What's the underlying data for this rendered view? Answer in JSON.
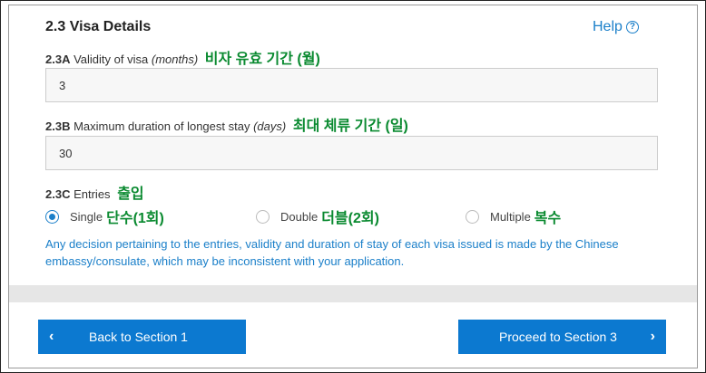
{
  "section": {
    "title": "2.3 Visa Details",
    "help_label": "Help",
    "help_icon": "?"
  },
  "validity": {
    "code": "2.3A",
    "label": "Validity of visa",
    "unit": "(months)",
    "korean": "비자 유효 기간 (월)",
    "value": "3"
  },
  "duration": {
    "code": "2.3B",
    "label": "Maximum duration of longest stay",
    "unit": "(days)",
    "korean": "최대 체류 기간 (일)",
    "value": "30"
  },
  "entries": {
    "code": "2.3C",
    "label": "Entries",
    "korean": "출입",
    "options": [
      {
        "label": "Single",
        "korean": "단수(1회)",
        "checked": true
      },
      {
        "label": "Double",
        "korean": "더블(2회)",
        "checked": false
      },
      {
        "label": "Multiple",
        "korean": "복수",
        "checked": false
      }
    ],
    "note": "Any decision pertaining to the entries, validity and duration of stay of each visa issued is made by the Chinese embassy/consulate, which may be inconsistent with your application."
  },
  "nav": {
    "back_label": "Back to Section 1",
    "next_label": "Proceed to Section 3"
  },
  "colors": {
    "accent": "#0c79d0",
    "link": "#1a7fc9",
    "korean_annotation": "#0a8a30"
  }
}
